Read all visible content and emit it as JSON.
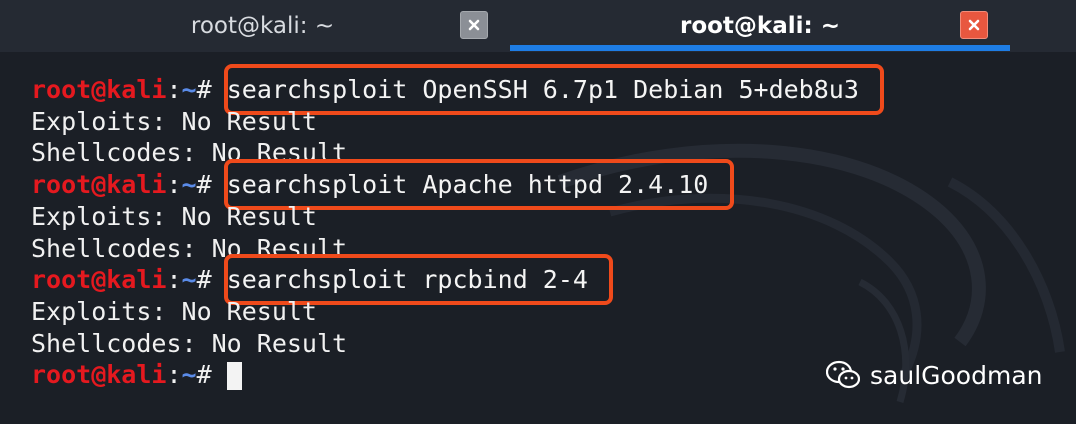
{
  "tabs": [
    {
      "title": "root@kali: ~",
      "active": false
    },
    {
      "title": "root@kali: ~",
      "active": true
    }
  ],
  "prompt": {
    "user_host": "root@kali",
    "separator": ":",
    "path": "~",
    "symbol": "#"
  },
  "terminal": {
    "lines": [
      {
        "type": "prompt",
        "command": "searchsploit OpenSSH 6.7p1 Debian 5+deb8u3"
      },
      {
        "type": "output",
        "text": "Exploits: No Result"
      },
      {
        "type": "output",
        "text": "Shellcodes: No Result"
      },
      {
        "type": "prompt",
        "command": "searchsploit Apache httpd 2.4.10"
      },
      {
        "type": "output",
        "text": "Exploits: No Result"
      },
      {
        "type": "output",
        "text": "Shellcodes: No Result"
      },
      {
        "type": "prompt",
        "command": "searchsploit rpcbind 2-4"
      },
      {
        "type": "output",
        "text": "Exploits: No Result"
      },
      {
        "type": "output",
        "text": "Shellcodes: No Result"
      },
      {
        "type": "prompt",
        "command": ""
      }
    ]
  },
  "watermark": {
    "text": "saulGoodman",
    "icon": "wechat-icon"
  },
  "colors": {
    "prompt_user": "#e5191f",
    "prompt_path": "#5a8be8",
    "highlight": "#ef4a1b",
    "active_tab_underline": "#1e7de5"
  }
}
